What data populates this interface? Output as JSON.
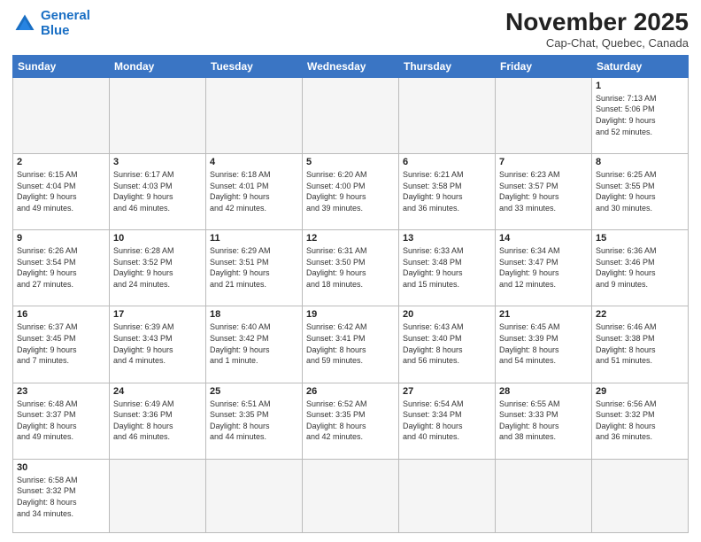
{
  "logo": {
    "line1": "General",
    "line2": "Blue"
  },
  "title": "November 2025",
  "subtitle": "Cap-Chat, Quebec, Canada",
  "days_header": [
    "Sunday",
    "Monday",
    "Tuesday",
    "Wednesday",
    "Thursday",
    "Friday",
    "Saturday"
  ],
  "weeks": [
    [
      {
        "num": "",
        "info": "",
        "empty": true
      },
      {
        "num": "",
        "info": "",
        "empty": true
      },
      {
        "num": "",
        "info": "",
        "empty": true
      },
      {
        "num": "",
        "info": "",
        "empty": true
      },
      {
        "num": "",
        "info": "",
        "empty": true
      },
      {
        "num": "",
        "info": "",
        "empty": true
      },
      {
        "num": "1",
        "info": "Sunrise: 7:13 AM\nSunset: 5:06 PM\nDaylight: 9 hours\nand 52 minutes.",
        "empty": false
      }
    ],
    [
      {
        "num": "2",
        "info": "Sunrise: 6:15 AM\nSunset: 4:04 PM\nDaylight: 9 hours\nand 49 minutes.",
        "empty": false
      },
      {
        "num": "3",
        "info": "Sunrise: 6:17 AM\nSunset: 4:03 PM\nDaylight: 9 hours\nand 46 minutes.",
        "empty": false
      },
      {
        "num": "4",
        "info": "Sunrise: 6:18 AM\nSunset: 4:01 PM\nDaylight: 9 hours\nand 42 minutes.",
        "empty": false
      },
      {
        "num": "5",
        "info": "Sunrise: 6:20 AM\nSunset: 4:00 PM\nDaylight: 9 hours\nand 39 minutes.",
        "empty": false
      },
      {
        "num": "6",
        "info": "Sunrise: 6:21 AM\nSunset: 3:58 PM\nDaylight: 9 hours\nand 36 minutes.",
        "empty": false
      },
      {
        "num": "7",
        "info": "Sunrise: 6:23 AM\nSunset: 3:57 PM\nDaylight: 9 hours\nand 33 minutes.",
        "empty": false
      },
      {
        "num": "8",
        "info": "Sunrise: 6:25 AM\nSunset: 3:55 PM\nDaylight: 9 hours\nand 30 minutes.",
        "empty": false
      }
    ],
    [
      {
        "num": "9",
        "info": "Sunrise: 6:26 AM\nSunset: 3:54 PM\nDaylight: 9 hours\nand 27 minutes.",
        "empty": false
      },
      {
        "num": "10",
        "info": "Sunrise: 6:28 AM\nSunset: 3:52 PM\nDaylight: 9 hours\nand 24 minutes.",
        "empty": false
      },
      {
        "num": "11",
        "info": "Sunrise: 6:29 AM\nSunset: 3:51 PM\nDaylight: 9 hours\nand 21 minutes.",
        "empty": false
      },
      {
        "num": "12",
        "info": "Sunrise: 6:31 AM\nSunset: 3:50 PM\nDaylight: 9 hours\nand 18 minutes.",
        "empty": false
      },
      {
        "num": "13",
        "info": "Sunrise: 6:33 AM\nSunset: 3:48 PM\nDaylight: 9 hours\nand 15 minutes.",
        "empty": false
      },
      {
        "num": "14",
        "info": "Sunrise: 6:34 AM\nSunset: 3:47 PM\nDaylight: 9 hours\nand 12 minutes.",
        "empty": false
      },
      {
        "num": "15",
        "info": "Sunrise: 6:36 AM\nSunset: 3:46 PM\nDaylight: 9 hours\nand 9 minutes.",
        "empty": false
      }
    ],
    [
      {
        "num": "16",
        "info": "Sunrise: 6:37 AM\nSunset: 3:45 PM\nDaylight: 9 hours\nand 7 minutes.",
        "empty": false
      },
      {
        "num": "17",
        "info": "Sunrise: 6:39 AM\nSunset: 3:43 PM\nDaylight: 9 hours\nand 4 minutes.",
        "empty": false
      },
      {
        "num": "18",
        "info": "Sunrise: 6:40 AM\nSunset: 3:42 PM\nDaylight: 9 hours\nand 1 minute.",
        "empty": false
      },
      {
        "num": "19",
        "info": "Sunrise: 6:42 AM\nSunset: 3:41 PM\nDaylight: 8 hours\nand 59 minutes.",
        "empty": false
      },
      {
        "num": "20",
        "info": "Sunrise: 6:43 AM\nSunset: 3:40 PM\nDaylight: 8 hours\nand 56 minutes.",
        "empty": false
      },
      {
        "num": "21",
        "info": "Sunrise: 6:45 AM\nSunset: 3:39 PM\nDaylight: 8 hours\nand 54 minutes.",
        "empty": false
      },
      {
        "num": "22",
        "info": "Sunrise: 6:46 AM\nSunset: 3:38 PM\nDaylight: 8 hours\nand 51 minutes.",
        "empty": false
      }
    ],
    [
      {
        "num": "23",
        "info": "Sunrise: 6:48 AM\nSunset: 3:37 PM\nDaylight: 8 hours\nand 49 minutes.",
        "empty": false
      },
      {
        "num": "24",
        "info": "Sunrise: 6:49 AM\nSunset: 3:36 PM\nDaylight: 8 hours\nand 46 minutes.",
        "empty": false
      },
      {
        "num": "25",
        "info": "Sunrise: 6:51 AM\nSunset: 3:35 PM\nDaylight: 8 hours\nand 44 minutes.",
        "empty": false
      },
      {
        "num": "26",
        "info": "Sunrise: 6:52 AM\nSunset: 3:35 PM\nDaylight: 8 hours\nand 42 minutes.",
        "empty": false
      },
      {
        "num": "27",
        "info": "Sunrise: 6:54 AM\nSunset: 3:34 PM\nDaylight: 8 hours\nand 40 minutes.",
        "empty": false
      },
      {
        "num": "28",
        "info": "Sunrise: 6:55 AM\nSunset: 3:33 PM\nDaylight: 8 hours\nand 38 minutes.",
        "empty": false
      },
      {
        "num": "29",
        "info": "Sunrise: 6:56 AM\nSunset: 3:32 PM\nDaylight: 8 hours\nand 36 minutes.",
        "empty": false
      }
    ],
    [
      {
        "num": "30",
        "info": "Sunrise: 6:58 AM\nSunset: 3:32 PM\nDaylight: 8 hours\nand 34 minutes.",
        "empty": false
      },
      {
        "num": "",
        "info": "",
        "empty": true
      },
      {
        "num": "",
        "info": "",
        "empty": true
      },
      {
        "num": "",
        "info": "",
        "empty": true
      },
      {
        "num": "",
        "info": "",
        "empty": true
      },
      {
        "num": "",
        "info": "",
        "empty": true
      },
      {
        "num": "",
        "info": "",
        "empty": true
      }
    ]
  ]
}
